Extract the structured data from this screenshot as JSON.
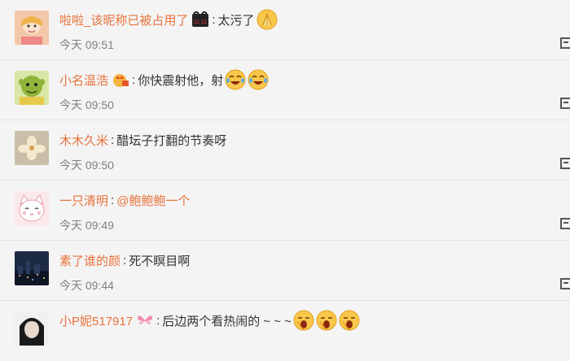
{
  "comments": [
    {
      "username": "啦啦_该昵称已被占用了",
      "badge": "tmall-1111-badge",
      "badge_text": "11.11",
      "text": "太污了",
      "emojis": [
        "folded-hands-emoji"
      ],
      "time": "今天 09:51",
      "avatar": "avatar-girl"
    },
    {
      "username": "小名温浩",
      "badge": "vip-crown-badge",
      "text": "你快震射他，射",
      "emojis": [
        "tears-of-joy-emoji",
        "tears-of-joy-emoji"
      ],
      "time": "今天 09:50",
      "avatar": "avatar-shrek"
    },
    {
      "username": "木木久米",
      "text": "醋坛子打翻的节奏呀",
      "emojis": [],
      "time": "今天 09:50",
      "avatar": "avatar-flower"
    },
    {
      "username": "一只清明",
      "mention": "@鲍鲍鲍一个",
      "text": "",
      "emojis": [],
      "time": "今天 09:49",
      "avatar": "avatar-cat"
    },
    {
      "username": "素了谁的颜",
      "text": "死不瞑目啊",
      "emojis": [],
      "time": "今天 09:44",
      "avatar": "avatar-night-city"
    },
    {
      "username": "小P妮517917",
      "badge": "butterfly-badge",
      "text": "后边两个看热闹的 ~ ~ ~",
      "emojis": [
        "yawn-emoji",
        "yawn-emoji",
        "yawn-emoji"
      ],
      "time": "",
      "avatar": "avatar-dark-hair"
    }
  ],
  "colors": {
    "username": "#e8723b",
    "text": "#333333",
    "time": "#808080",
    "background": "#f4f4f4"
  }
}
